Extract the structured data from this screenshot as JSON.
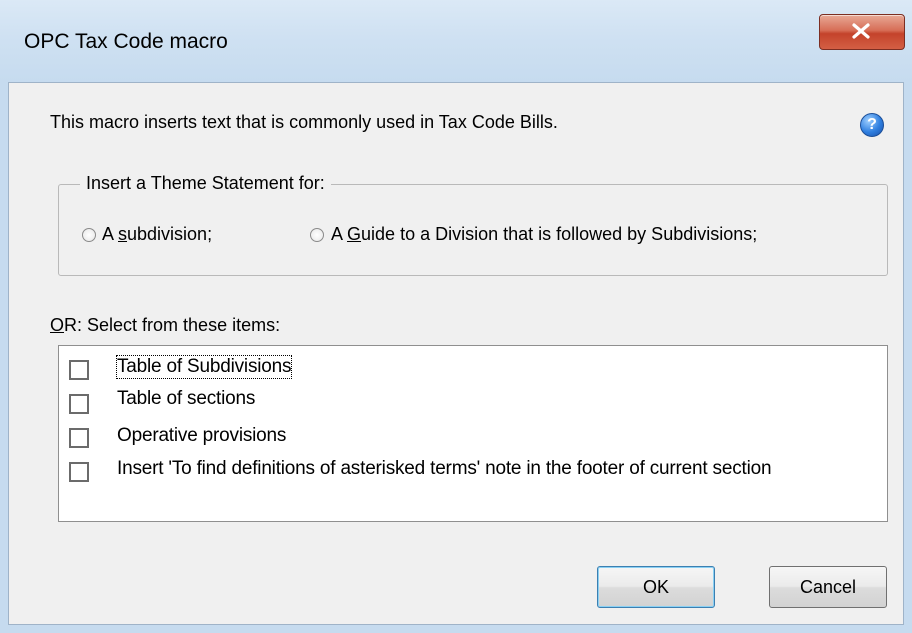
{
  "window": {
    "title": "OPC Tax Code macro"
  },
  "intro_text": "This macro inserts text that is commonly used in Tax Code Bills.",
  "help_icon_glyph": "?",
  "theme_group": {
    "legend": "Insert a Theme Statement for:",
    "options": [
      {
        "prefix": "A ",
        "access_key": "s",
        "rest": "ubdivision;",
        "selected": false
      },
      {
        "prefix": "A ",
        "access_key": "G",
        "rest": "uide to a Division that is followed by Subdivisions;",
        "selected": false
      }
    ]
  },
  "select_label": {
    "access_key": "O",
    "rest": "R: Select from these items:"
  },
  "items": [
    {
      "label": "Table of Subdivisions",
      "checked": false
    },
    {
      "label": "Table of sections",
      "checked": false
    },
    {
      "label": "Operative provisions",
      "checked": false
    },
    {
      "label": "Insert 'To find definitions of asterisked terms' note in the footer of current section",
      "checked": false
    }
  ],
  "buttons": {
    "ok": "OK",
    "cancel": "Cancel"
  }
}
